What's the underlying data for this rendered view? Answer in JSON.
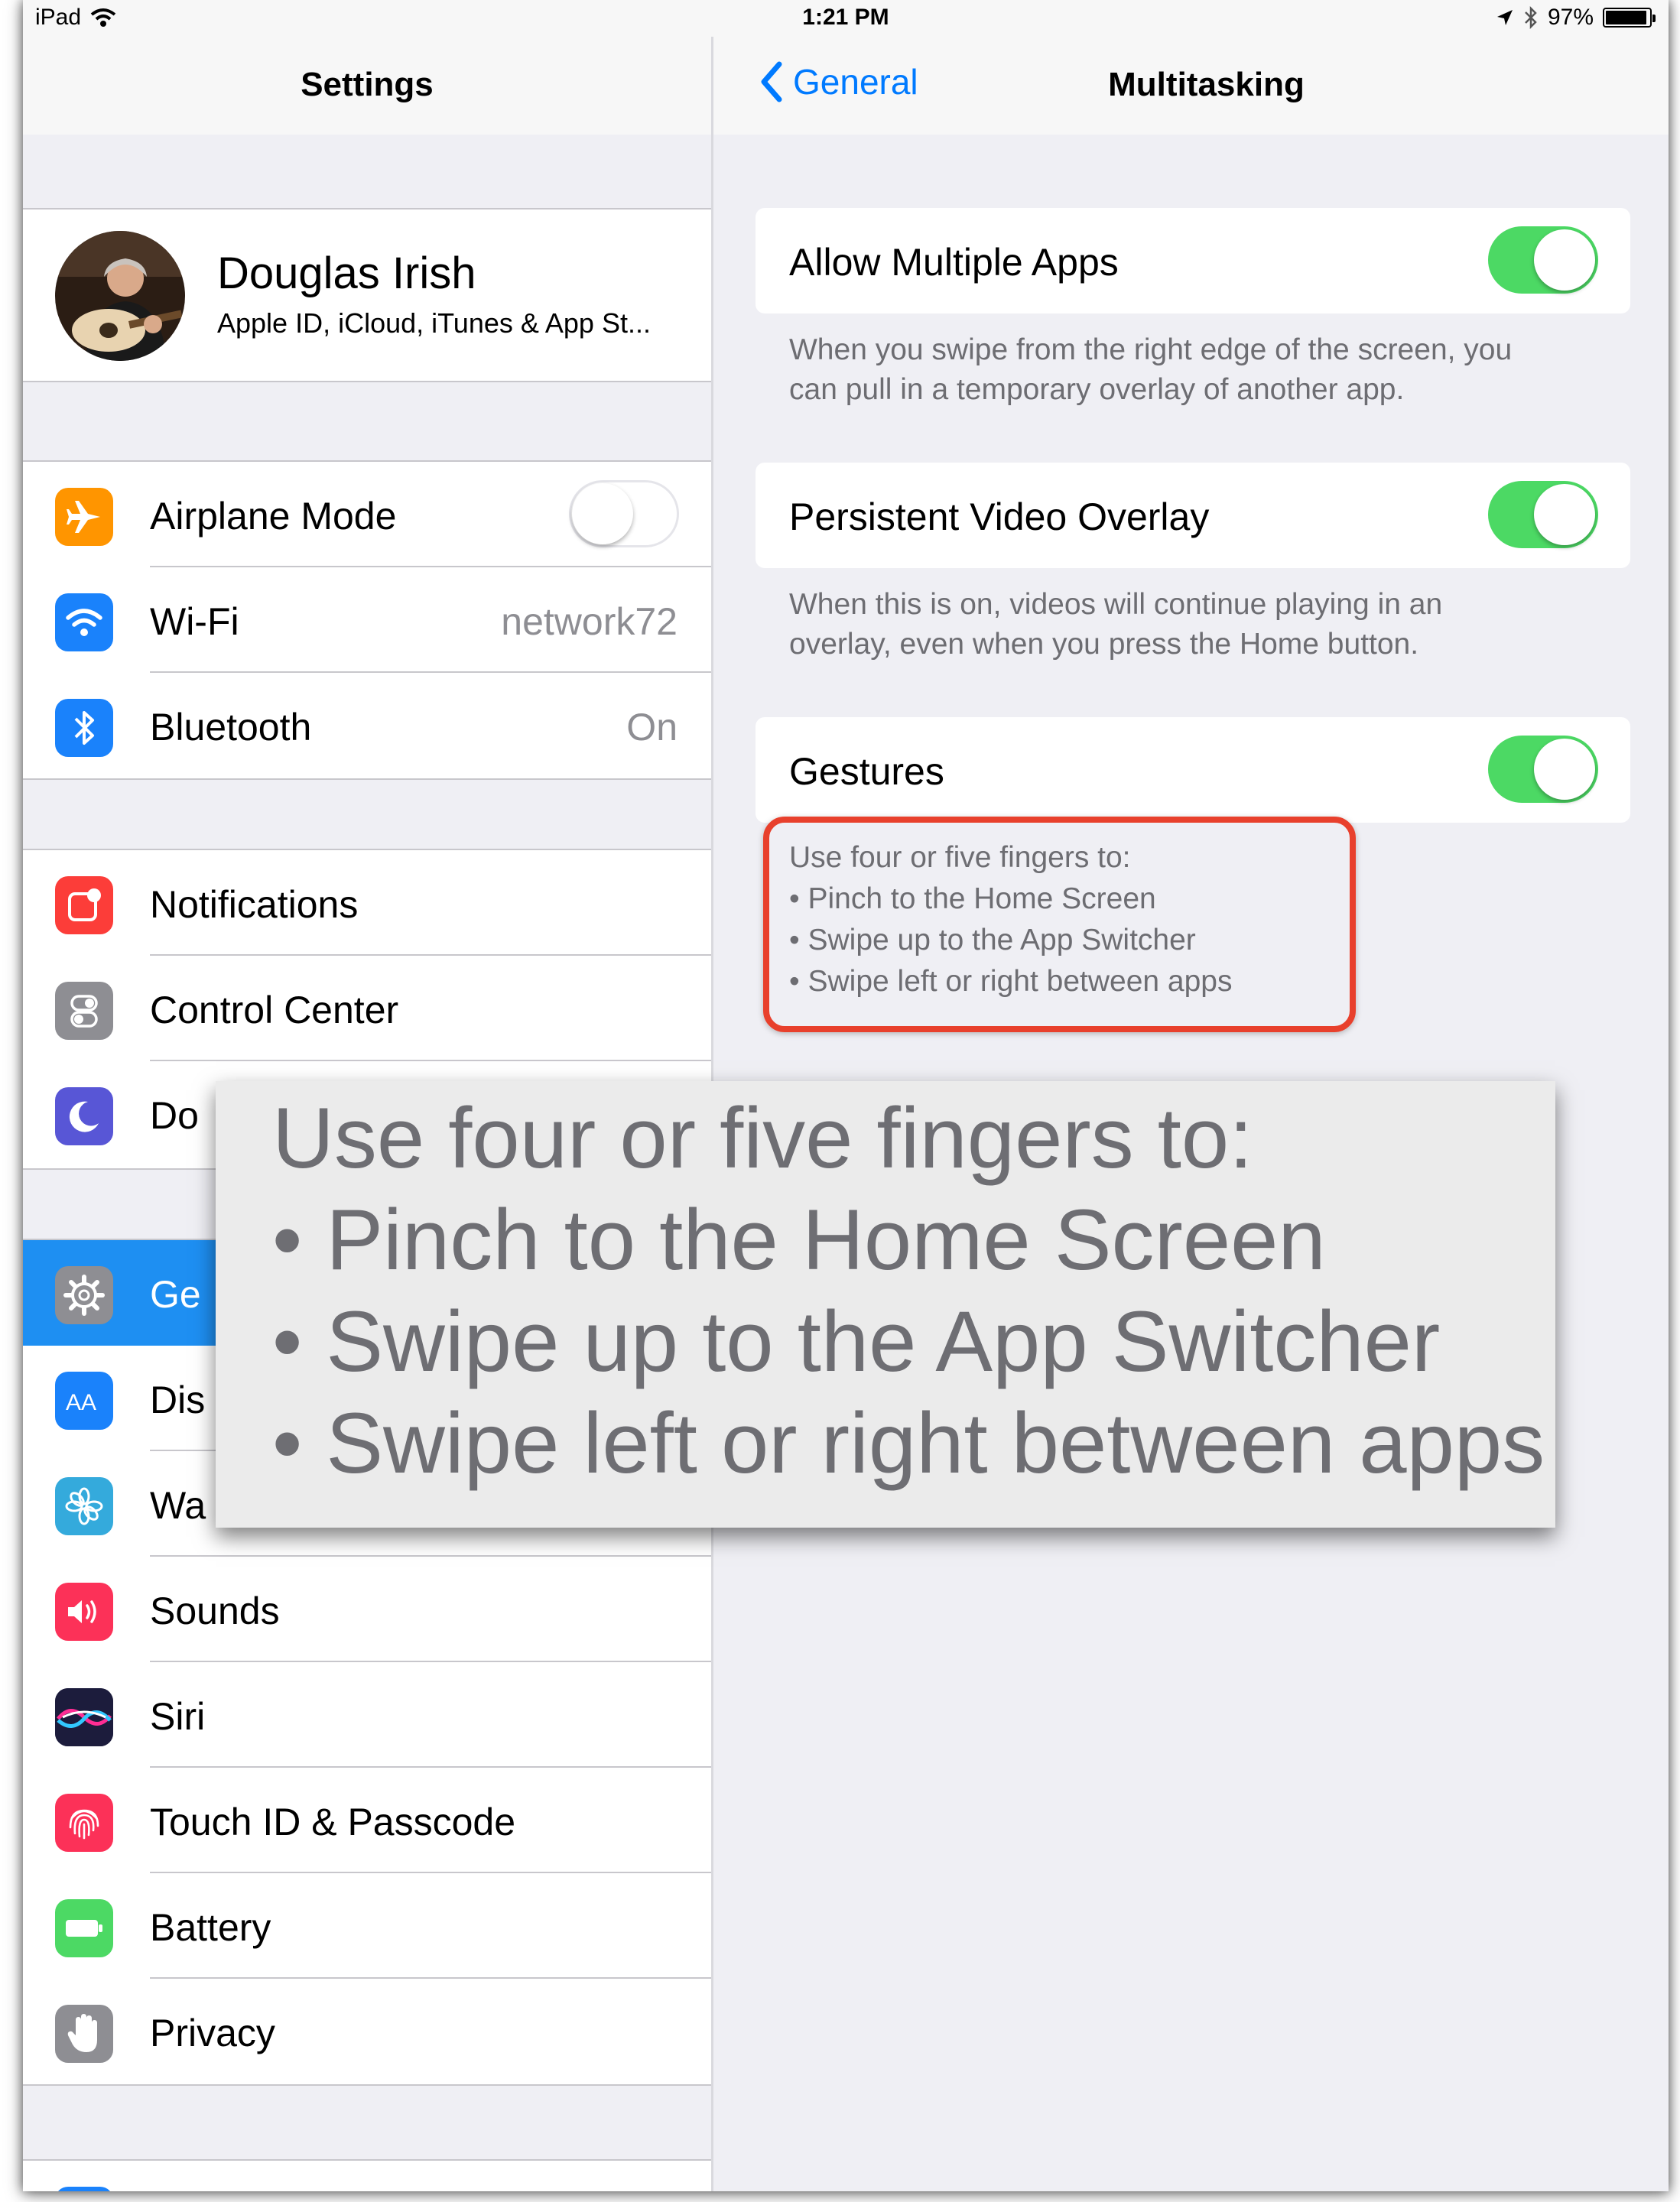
{
  "status_bar": {
    "device": "iPad",
    "time": "1:21 PM",
    "battery": "97%"
  },
  "left_nav": {
    "title": "Settings"
  },
  "right_nav": {
    "back_label": "General",
    "title": "Multitasking"
  },
  "profile": {
    "name": "Douglas Irish",
    "subtitle": "Apple ID, iCloud, iTunes & App St..."
  },
  "connectivity": [
    {
      "label": "Airplane Mode",
      "icon": "airplane-icon",
      "color": "#ff9500",
      "toggle": false
    },
    {
      "label": "Wi-Fi",
      "icon": "wifi-icon",
      "color": "#1a82fb",
      "value": "network72"
    },
    {
      "label": "Bluetooth",
      "icon": "bluetooth-icon",
      "color": "#1a82fb",
      "value": "On"
    }
  ],
  "system": [
    {
      "label": "Notifications",
      "icon": "notifications-icon",
      "color": "#fc3d39"
    },
    {
      "label": "Control Center",
      "icon": "control-center-icon",
      "color": "#8e8e93"
    },
    {
      "label": "Do",
      "icon": "moon-icon",
      "color": "#5856d6"
    }
  ],
  "general_group": [
    {
      "label": "Ge",
      "icon": "gear-icon",
      "color": "#8e8e93",
      "selected": true
    },
    {
      "label": "Dis",
      "icon": "display-icon",
      "color": "#1a82fb"
    },
    {
      "label": "Wa",
      "icon": "wallpaper-icon",
      "color": "#34aadc"
    },
    {
      "label": "Sounds",
      "icon": "sounds-icon",
      "color": "#fc3158"
    },
    {
      "label": "Siri",
      "icon": "siri-icon",
      "color": "#1c1c3c"
    },
    {
      "label": "Touch ID & Passcode",
      "icon": "fingerprint-icon",
      "color": "#fc3158"
    },
    {
      "label": "Battery",
      "icon": "battery-icon",
      "color": "#4cd964"
    },
    {
      "label": "Privacy",
      "icon": "hand-icon",
      "color": "#8e8e93"
    }
  ],
  "multitasking": [
    {
      "label": "Allow Multiple Apps",
      "on": true,
      "footer": [
        "When you swipe from the right edge of the screen, you",
        "can pull in a temporary overlay of another app."
      ]
    },
    {
      "label": "Persistent Video Overlay",
      "on": true,
      "footer": [
        "When this is on, videos will continue playing in an",
        "overlay, even when you press the Home button."
      ]
    },
    {
      "label": "Gestures",
      "on": true,
      "footer": [
        "Use four or five fingers to:",
        "• Pinch to the Home Screen",
        "• Swipe up to the App Switcher",
        "• Swipe left or right between apps"
      ]
    }
  ],
  "callout": {
    "color": "#e8402c",
    "lines": [
      "Use four or five fingers to:",
      "• Pinch to the Home Screen",
      "• Swipe up to the App Switcher",
      "• Swipe left or right between apps"
    ]
  },
  "colors": {
    "accent": "#007aff",
    "toggle_on": "#4cd964",
    "selected_row": "#1e8ff2"
  }
}
